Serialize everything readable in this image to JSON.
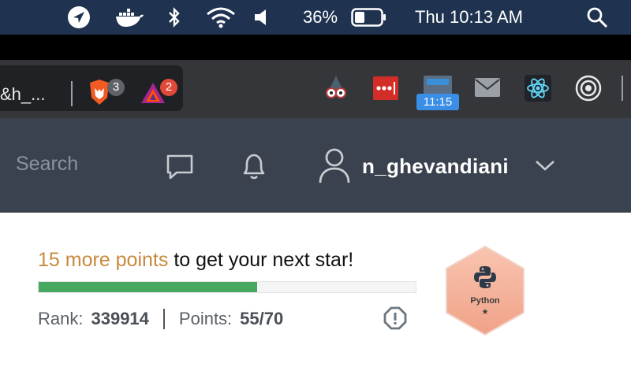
{
  "menubar": {
    "battery_percent": "36%",
    "clock": "Thu 10:13 AM",
    "icons": [
      "location-arrow-icon",
      "docker-icon",
      "bluetooth-icon",
      "wifi-icon",
      "volume-icon",
      "battery-icon",
      "spotlight-search-icon"
    ]
  },
  "toolbar": {
    "url_fragment": "&h_...",
    "brave_badge": "3",
    "rewards_badge": "2",
    "clock_extension_time": "11:15",
    "extensions": [
      "brave-shields-icon",
      "brave-rewards-icon",
      "spy-extension-icon",
      "lastpass-icon",
      "clock-extension-icon",
      "mail-icon",
      "react-devtools-icon",
      "record-icon"
    ]
  },
  "header": {
    "search_placeholder": "Search",
    "username": "n_ghevandiani"
  },
  "progress": {
    "points_needed": "15 more points",
    "rest_text": " to get your next star!",
    "fraction": 0.58,
    "rank_label": "Rank:",
    "rank_value": "339914",
    "points_label": "Points:",
    "points_value": "55/70"
  },
  "badge": {
    "name": "Python",
    "stars": "★"
  },
  "colors": {
    "menubar_bg": "#1f3350",
    "site_header_bg": "#39424e",
    "highlight": "#c8893c",
    "progress_green": "#47a860",
    "badge_fill": "#f6b4a0"
  }
}
